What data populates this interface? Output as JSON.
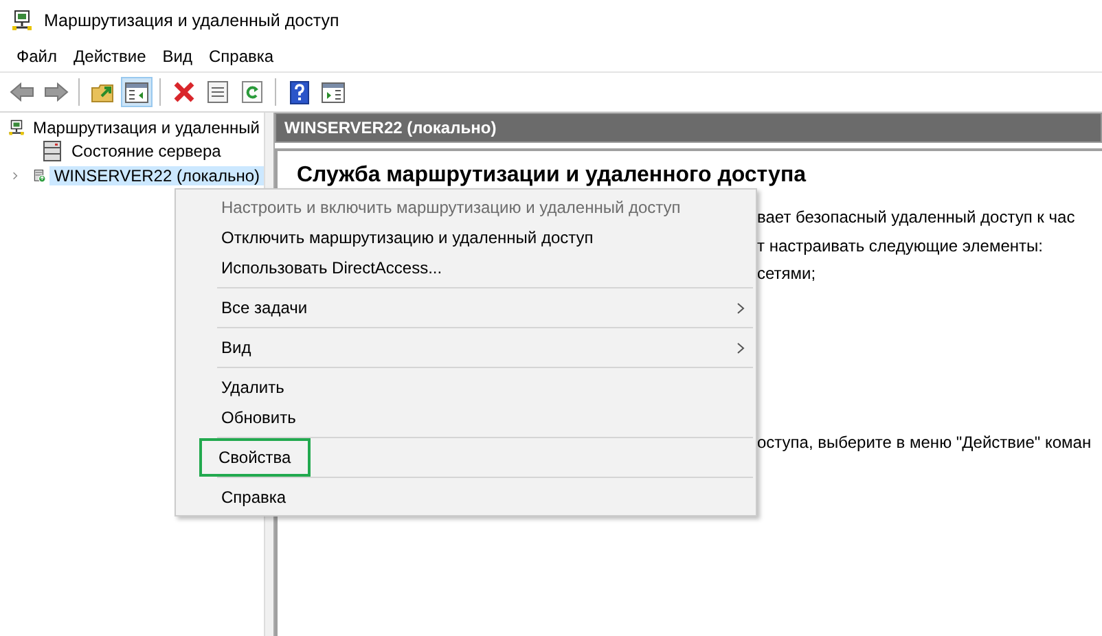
{
  "window": {
    "title": "Маршрутизация и удаленный доступ"
  },
  "menu_bar": [
    "Файл",
    "Действие",
    "Вид",
    "Справка"
  ],
  "toolbar": [
    {
      "kind": "back",
      "pressed": false
    },
    {
      "kind": "forward",
      "pressed": false
    },
    {
      "kind": "sep"
    },
    {
      "kind": "up",
      "pressed": false
    },
    {
      "kind": "tree",
      "pressed": true
    },
    {
      "kind": "sep"
    },
    {
      "kind": "delete",
      "pressed": false
    },
    {
      "kind": "props",
      "pressed": false
    },
    {
      "kind": "refresh",
      "pressed": false
    },
    {
      "kind": "sep"
    },
    {
      "kind": "help",
      "pressed": false
    },
    {
      "kind": "pane",
      "pressed": false
    }
  ],
  "tree": {
    "label": "Маршрутизация и удаленный",
    "children": [
      {
        "label": "Состояние сервера",
        "kind": "status",
        "selected": false,
        "expandable": false
      },
      {
        "label": "WINSERVER22 (локально)",
        "kind": "server",
        "selected": true,
        "expandable": true
      }
    ]
  },
  "details": {
    "header": "WINSERVER22 (локально)",
    "heading": "Служба маршрутизации и удаленного доступа",
    "lines": [
      "вает безопасный удаленный доступ к час",
      "т настраивать следующие элементы:",
      "сетями;"
    ],
    "note": "оступа, выберите в меню \"Действие\" коман"
  },
  "context_menu": [
    {
      "kind": "item",
      "label": "Настроить и включить маршрутизацию и удаленный доступ",
      "disabled": true,
      "submenu": false,
      "outlined": false
    },
    {
      "kind": "item",
      "label": "Отключить маршрутизацию и удаленный доступ",
      "disabled": false,
      "submenu": false,
      "outlined": false
    },
    {
      "kind": "item",
      "label": "Использовать DirectAccess...",
      "disabled": false,
      "submenu": false,
      "outlined": false
    },
    {
      "kind": "separator"
    },
    {
      "kind": "item",
      "label": "Все задачи",
      "disabled": false,
      "submenu": true,
      "outlined": false
    },
    {
      "kind": "separator"
    },
    {
      "kind": "item",
      "label": "Вид",
      "disabled": false,
      "submenu": true,
      "outlined": false
    },
    {
      "kind": "separator"
    },
    {
      "kind": "item",
      "label": "Удалить",
      "disabled": false,
      "submenu": false,
      "outlined": false
    },
    {
      "kind": "item",
      "label": "Обновить",
      "disabled": false,
      "submenu": false,
      "outlined": false
    },
    {
      "kind": "separator"
    },
    {
      "kind": "item",
      "label": "Свойства",
      "disabled": false,
      "submenu": false,
      "outlined": true
    },
    {
      "kind": "separator"
    },
    {
      "kind": "item",
      "label": "Справка",
      "disabled": false,
      "submenu": false,
      "outlined": false
    }
  ]
}
